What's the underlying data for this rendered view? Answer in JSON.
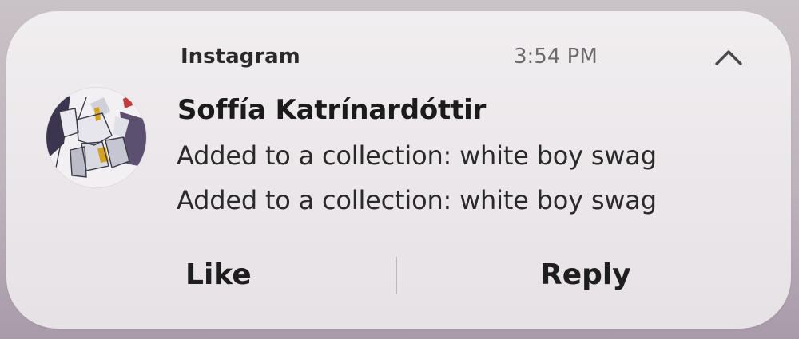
{
  "notification": {
    "app_name": "Instagram",
    "time": "3:54 PM",
    "sender": "Soffía Katrínardóttir",
    "messages": [
      "Added to a collection: white boy swag",
      "Added to a collection: white boy swag"
    ],
    "collapse_icon": "chevron-up-icon",
    "avatar_icon": "gundam-robot-avatar"
  },
  "actions": {
    "like_label": "Like",
    "reply_label": "Reply"
  },
  "colors": {
    "card_background": "#ece8eb",
    "primary_text": "#1b1b1b",
    "secondary_text": "#6c6a6c"
  }
}
